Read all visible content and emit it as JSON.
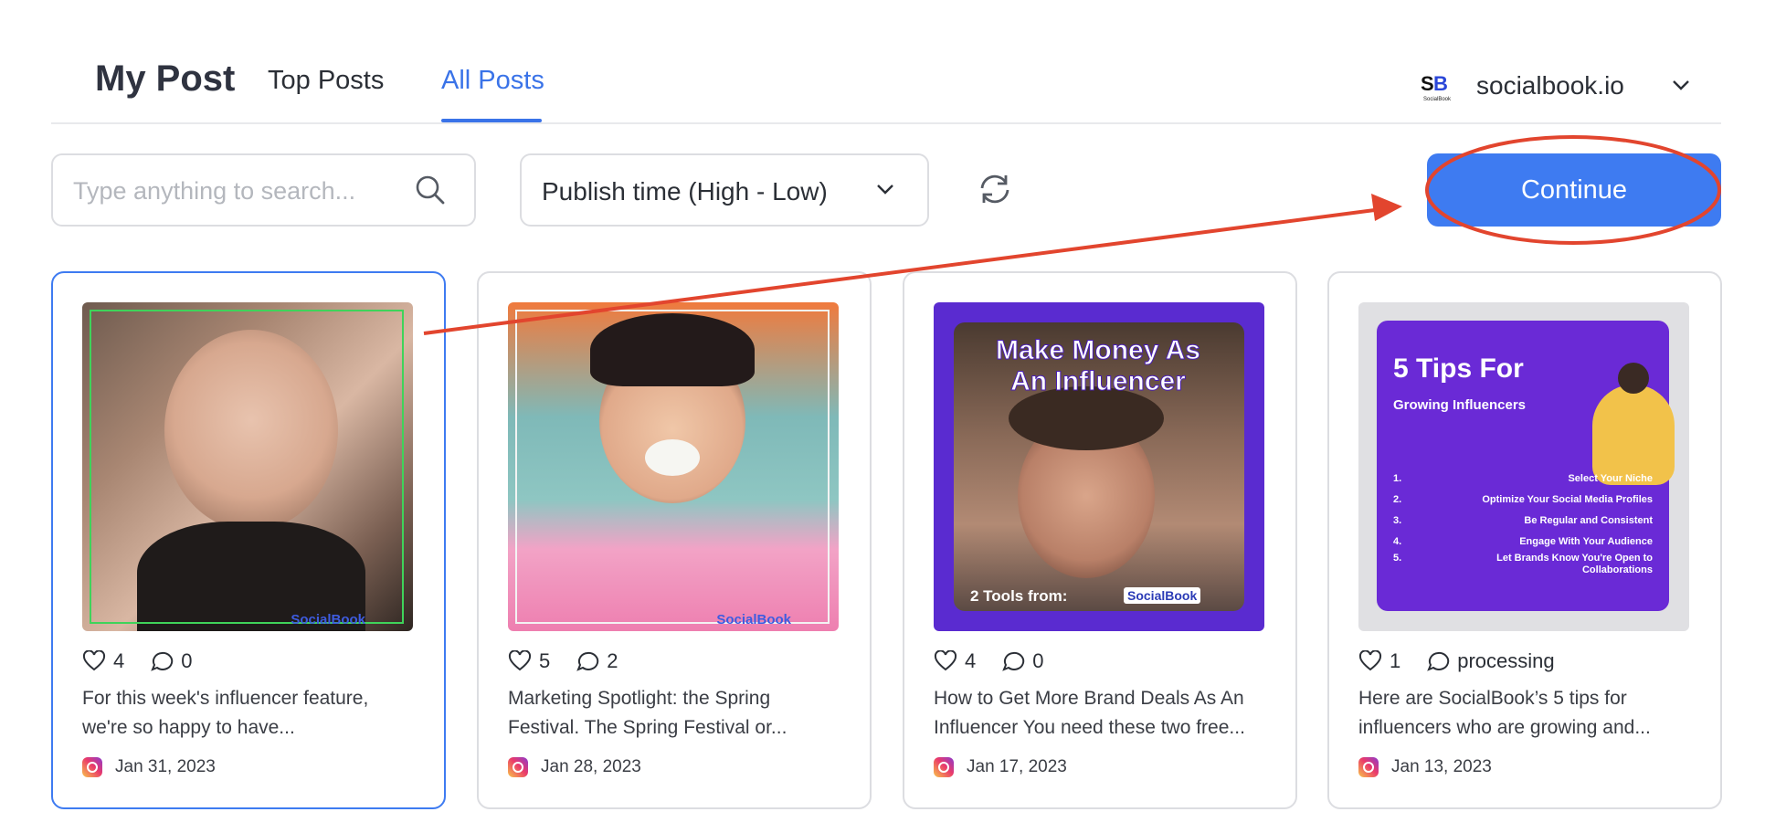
{
  "header": {
    "title": "My Post",
    "tabs": [
      {
        "label": "Top Posts",
        "active": false
      },
      {
        "label": "All Posts",
        "active": true
      }
    ],
    "account": {
      "name": "socialbook.io",
      "logo_text": "SB",
      "logo_caption": "SocialBook"
    }
  },
  "toolbar": {
    "search_placeholder": "Type anything to search...",
    "sort_value": "Publish time (High - Low)",
    "continue_label": "Continue"
  },
  "colors": {
    "accent": "#3e7bf1",
    "annotation": "#e2452e"
  },
  "posts": [
    {
      "likes": "4",
      "comments": "0",
      "caption_line1": "For this week's influencer feature,",
      "caption_line2": "we're so happy to have...",
      "date": "Jan 31, 2023",
      "platform": "instagram",
      "selected": true,
      "watermark": "SocialBook"
    },
    {
      "likes": "5",
      "comments": "2",
      "caption_line1": "Marketing Spotlight: the Spring",
      "caption_line2": "Festival. The Spring Festival or...",
      "date": "Jan 28, 2023",
      "platform": "instagram",
      "selected": false,
      "watermark": "SocialBook"
    },
    {
      "likes": "4",
      "comments": "0",
      "caption_line1": "How to Get More Brand Deals As An",
      "caption_line2": "Influencer You need these two free...",
      "date": "Jan 17, 2023",
      "platform": "instagram",
      "selected": false,
      "image_headline_1": "Make Money As",
      "image_headline_2": "An Influencer",
      "image_footer": "2 Tools from:",
      "image_brand": "SocialBook"
    },
    {
      "likes": "1",
      "comments": "processing",
      "caption_line1": "Here are SocialBook’s 5 tips for",
      "caption_line2": "influencers who are growing and...",
      "date": "Jan 13, 2023",
      "platform": "instagram",
      "selected": false,
      "image_title": "5 Tips For",
      "image_subtitle": "Growing Influencers",
      "image_tips": [
        {
          "n": "1.",
          "t": "Select Your Niche"
        },
        {
          "n": "2.",
          "t": "Optimize Your Social Media Profiles"
        },
        {
          "n": "3.",
          "t": "Be Regular and Consistent"
        },
        {
          "n": "4.",
          "t": "Engage With Your Audience"
        },
        {
          "n": "5.",
          "t": "Let Brands Know You're Open to Collaborations"
        }
      ]
    }
  ]
}
